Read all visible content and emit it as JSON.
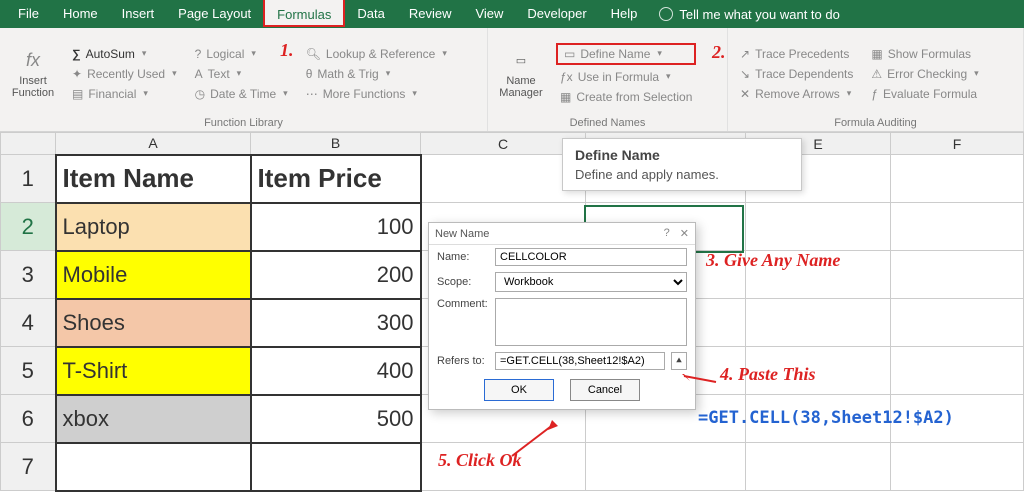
{
  "tabs": {
    "file": "File",
    "home": "Home",
    "insert": "Insert",
    "page_layout": "Page Layout",
    "formulas": "Formulas",
    "data": "Data",
    "review": "Review",
    "view": "View",
    "developer": "Developer",
    "help": "Help",
    "tell": "Tell me what you want to do"
  },
  "ribbon": {
    "insert_function": "Insert Function",
    "autosum": "AutoSum",
    "recently_used": "Recently Used",
    "financial": "Financial",
    "logical": "Logical",
    "text": "Text",
    "date_time": "Date & Time",
    "lookup": "Lookup & Reference",
    "math_trig": "Math & Trig",
    "more_functions": "More Functions",
    "function_library": "Function Library",
    "name_manager": "Name Manager",
    "define_name": "Define Name",
    "use_in_formula": "Use in Formula",
    "create_selection": "Create from Selection",
    "defined_names": "Defined Names",
    "trace_precedents": "Trace Precedents",
    "trace_dependents": "Trace Dependents",
    "remove_arrows": "Remove Arrows",
    "show_formulas": "Show Formulas",
    "error_checking": "Error Checking",
    "evaluate_formula": "Evaluate Formula",
    "formula_auditing": "Formula Auditing"
  },
  "tooltip": {
    "title": "Define Name",
    "body": "Define and apply names."
  },
  "columns": [
    "A",
    "B",
    "C",
    "D",
    "E",
    "F"
  ],
  "headers": {
    "item_name": "Item Name",
    "item_price": "Item Price"
  },
  "rows": [
    {
      "n": "1"
    },
    {
      "n": "2",
      "item": "Laptop",
      "price": "100",
      "color": "#fbe0b0"
    },
    {
      "n": "3",
      "item": "Mobile",
      "price": "200",
      "color": "#ffff00"
    },
    {
      "n": "4",
      "item": "Shoes",
      "price": "300",
      "color": "#f4c7a8"
    },
    {
      "n": "5",
      "item": "T-Shirt",
      "price": "400",
      "color": "#ffff00"
    },
    {
      "n": "6",
      "item": "xbox",
      "price": "500",
      "color": "#cfcfcf"
    },
    {
      "n": "7"
    }
  ],
  "dialog": {
    "title": "New Name",
    "name_lbl": "Name:",
    "name_val": "CELLCOLOR",
    "scope_lbl": "Scope:",
    "scope_val": "Workbook",
    "comment_lbl": "Comment:",
    "refers_lbl": "Refers to:",
    "refers_val": "=GET.CELL(38,Sheet12!$A2)",
    "ok": "OK",
    "cancel": "Cancel"
  },
  "annotations": {
    "a1": "1.",
    "a2": "2.",
    "a3": "3. Give Any Name",
    "a4": "4. Paste This",
    "a5": "5. Click Ok",
    "formula": "=GET.CELL(38,Sheet12!$A2)"
  }
}
